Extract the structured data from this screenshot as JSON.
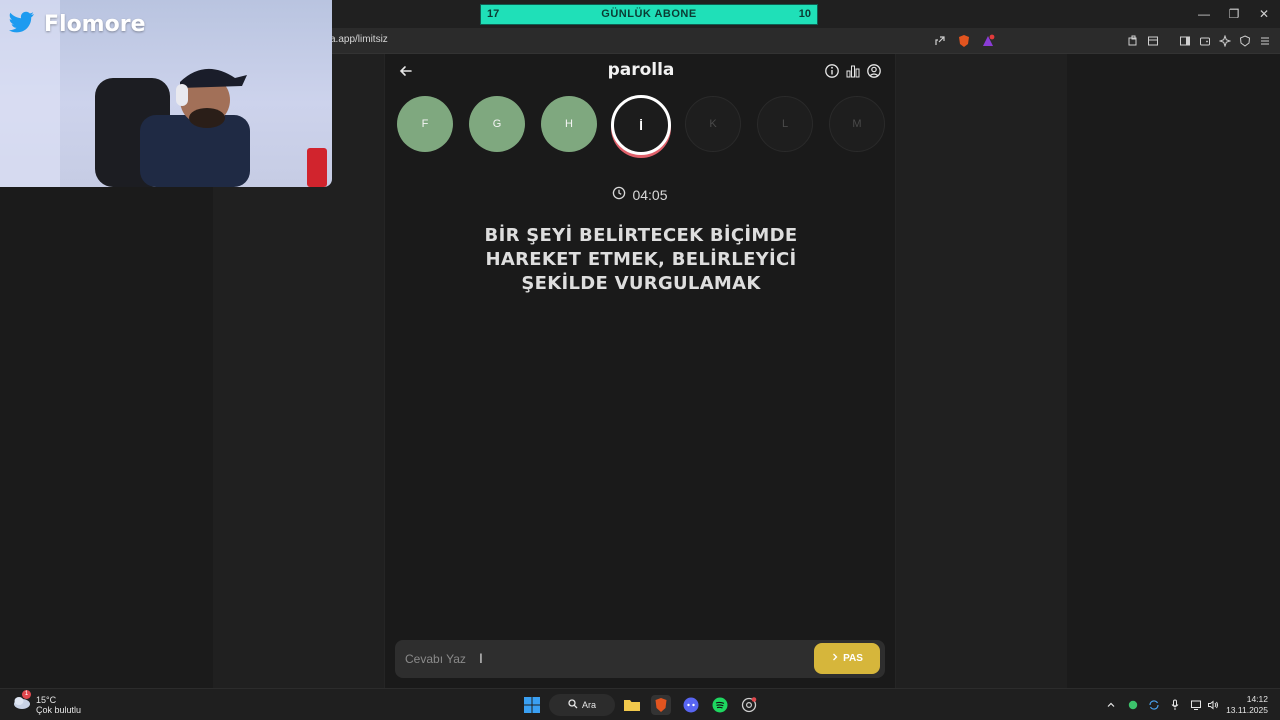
{
  "browser": {
    "url": "a.app/limitsiz",
    "window_controls": [
      "minimize-icon",
      "restore-icon",
      "close-icon"
    ],
    "toolbar_icons": [
      "share-icon",
      "brave-shield-icon",
      "brave-rewards-icon",
      "extensions-icon",
      "tab-icon",
      "sidebar-icon",
      "wallet-icon",
      "leo-icon",
      "vpn-icon",
      "menu-icon"
    ]
  },
  "overlay": {
    "brand_name": "Flomore",
    "goal_left": "17",
    "goal_label": "GÜNLÜK ABONE",
    "goal_right": "10",
    "goal_progress": 0.0,
    "accent": "#1fe0b8"
  },
  "app": {
    "title": "parolla",
    "header_icons": [
      "info-icon",
      "stats-icon",
      "user-icon"
    ],
    "letters": [
      {
        "char": "F",
        "state": "done"
      },
      {
        "char": "G",
        "state": "done"
      },
      {
        "char": "H",
        "state": "done"
      },
      {
        "char": "İ",
        "state": "active"
      },
      {
        "char": "K",
        "state": "todo"
      },
      {
        "char": "L",
        "state": "todo"
      },
      {
        "char": "M",
        "state": "todo"
      }
    ],
    "timer": "04:05",
    "question": "BİR ŞEYİ BELİRTECEK BİÇİMDE HAREKET ETMEK, BELİRLEYİCİ ŞEKİLDE VURGULAMAK",
    "answer_placeholder": "Cevabı Yaz",
    "pass_label": "PAS",
    "colors": {
      "done": "#7fa87f",
      "pass": "#d6b63b",
      "active_ring": "#e0606a"
    }
  },
  "taskbar": {
    "temperature": "15°C",
    "weather_desc": "Çok bulutlu",
    "weather_badge": "1",
    "search_label": "Ara",
    "apps": [
      "windows-start-icon",
      "search-icon",
      "file-explorer-icon",
      "brave-browser-icon",
      "discord-icon",
      "spotify-icon",
      "chrome-like-icon"
    ],
    "time": "14:12",
    "date": "13.11.2025"
  }
}
